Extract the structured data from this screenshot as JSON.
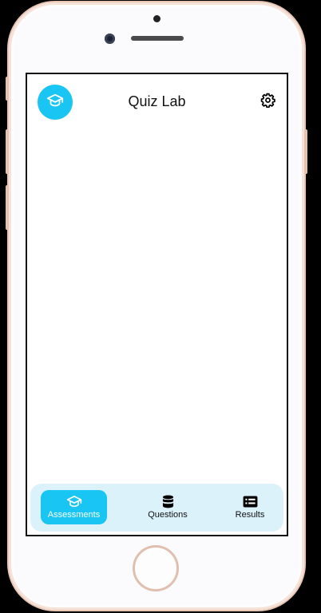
{
  "header": {
    "title": "Quiz Lab",
    "logo_icon": "graduation-cap-icon",
    "settings_icon": "gear-icon"
  },
  "nav": {
    "items": [
      {
        "label": "Assessments",
        "icon": "graduation-cap-icon",
        "active": true
      },
      {
        "label": "Questions",
        "icon": "database-icon",
        "active": false
      },
      {
        "label": "Results",
        "icon": "list-card-icon",
        "active": false
      }
    ]
  },
  "colors": {
    "accent": "#18c5f3",
    "nav_background": "#dbf2fb",
    "device_frame": "#e9c7b7"
  }
}
